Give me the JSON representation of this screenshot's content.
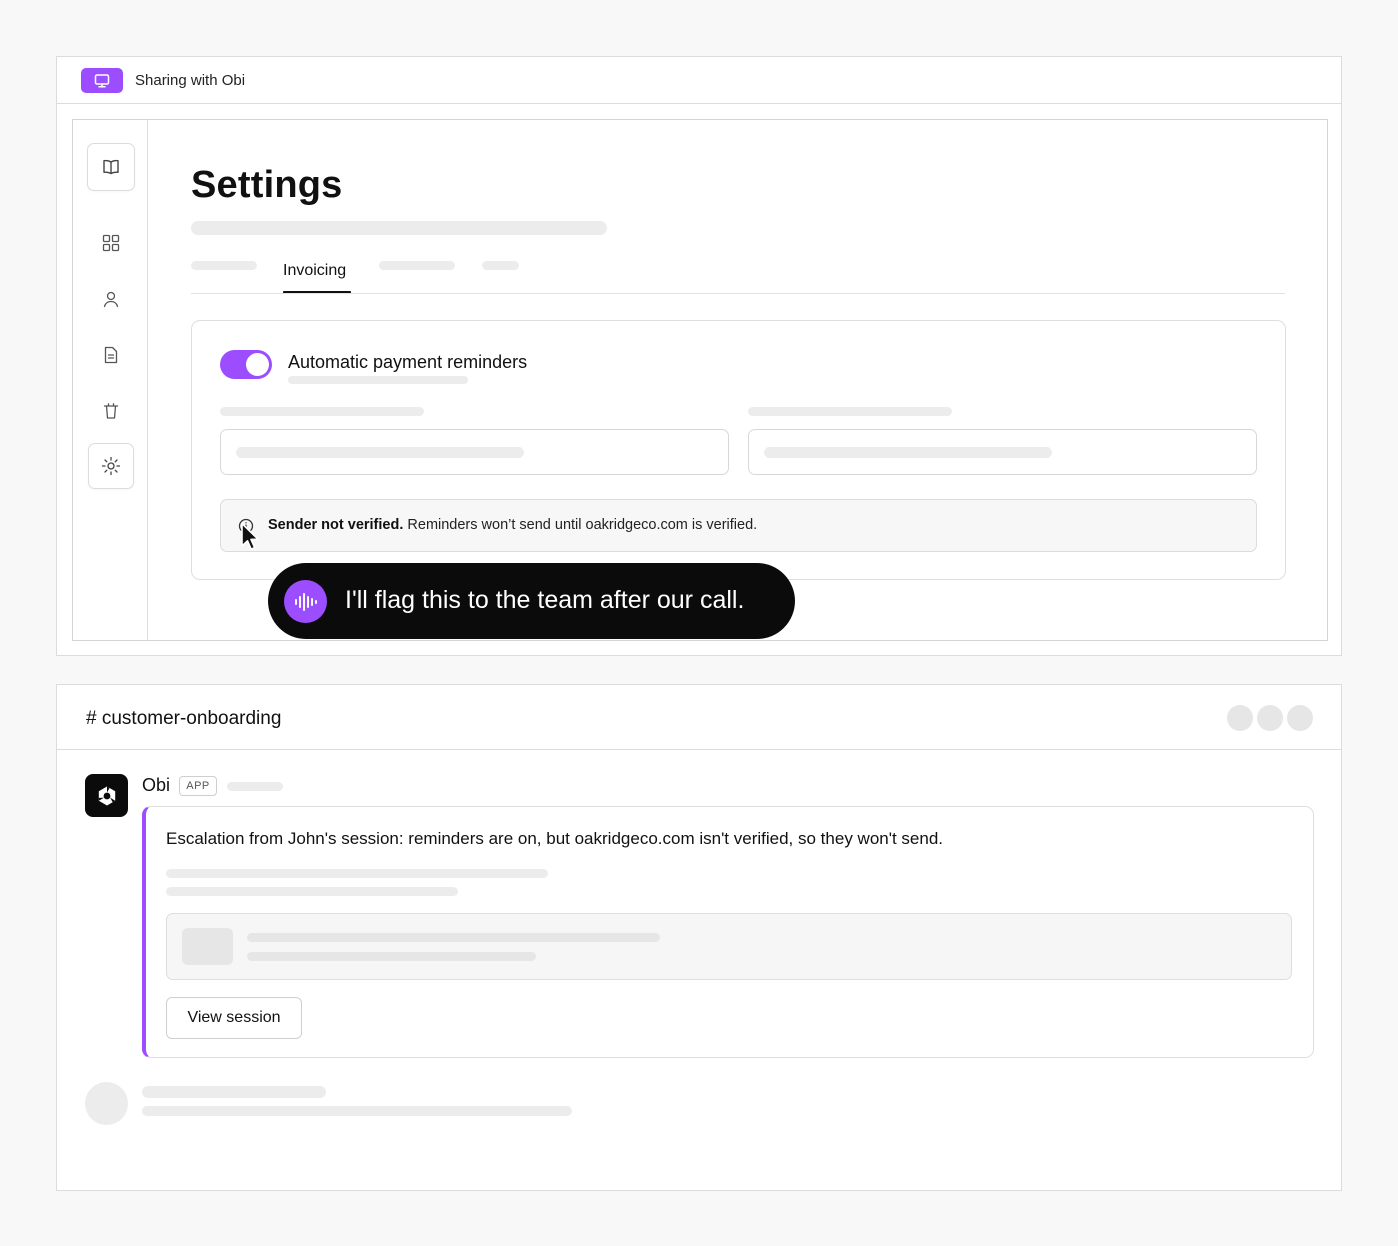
{
  "share_bar": {
    "label": "Sharing with Obi"
  },
  "sidebar": {
    "items": [
      {
        "icon": "book-icon"
      },
      {
        "icon": "grid-icon"
      },
      {
        "icon": "user-icon"
      },
      {
        "icon": "document-icon"
      },
      {
        "icon": "trash-icon"
      },
      {
        "icon": "gear-icon",
        "active": true
      }
    ]
  },
  "settings": {
    "title": "Settings",
    "active_tab": "Invoicing",
    "card": {
      "title": "Automatic payment reminders",
      "toggle_on": true,
      "warning": {
        "strong": "Sender not verified.",
        "text": " Reminders won’t send until oakridgeco.com is verified."
      }
    }
  },
  "voice_bubble": {
    "text": "I'll flag this to the team after our call."
  },
  "chat": {
    "channel": "# customer-onboarding",
    "message": {
      "author": "Obi",
      "tag": "APP",
      "text": "Escalation from John's session: reminders are on, but oakridgeco.com isn't verified, so they won't send.",
      "button": "View session"
    }
  },
  "colors": {
    "accent": "#9b4dff",
    "dark": "#0b0b0b",
    "skeleton": "#ececec"
  }
}
